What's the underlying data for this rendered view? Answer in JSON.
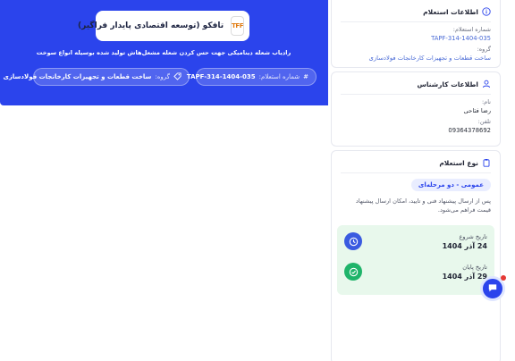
{
  "header": {
    "company_name": "تافکو (توسعه اقتصادی پایدار فراگیر)",
    "logo_text": "TFF",
    "title": "رادیاب شعله دینامیکی جهت حس کردن شعله مشعل‌هاش تولید شده بوسیله انواع سوخت",
    "number_label": "شماره استعلام:",
    "number_value": "TAPF-314-1404-035",
    "group_label": "گروه:",
    "group_value": "ساخت قطعات و تجهیزات کارخانجات فولادسازی"
  },
  "inquiry_info": {
    "heading": "اطلاعات استعلام",
    "number_label": "شماره استعلام:",
    "number_value": "TAPF-314-1404-035",
    "group_label": "گروه:",
    "group_value": "ساخت قطعات و تجهیزات کارخانجات فولادسازی"
  },
  "expert_info": {
    "heading": "اطلاعات کارشناس",
    "name_label": "نام:",
    "name_value": "رضا فتاحی",
    "phone_label": "تلفن:",
    "phone_value": "09364378692"
  },
  "inquiry_type": {
    "heading": "نوع استعلام",
    "badge": "عمومی - دو مرحله‌ای",
    "description": "پس از ارسال پیشنهاد فنی و تایید، امکان ارسال پیشنهاد قیمت فراهم می‌شود.",
    "start_label": "تاریخ شروع",
    "start_value": "24 آذر 1404",
    "end_label": "تاریخ پایان",
    "end_value": "29 آذر 1404"
  },
  "colors": {
    "primary": "#2b44ec",
    "success": "#1fb46a",
    "date_panel": "#e8f8ec"
  },
  "icons": {
    "info": "info-icon",
    "user": "user-icon",
    "clipboard": "clipboard-icon",
    "hash": "hash-icon",
    "tag": "tag-icon",
    "clock": "clock-icon",
    "check": "check-circle-icon",
    "chat": "chat-icon"
  }
}
